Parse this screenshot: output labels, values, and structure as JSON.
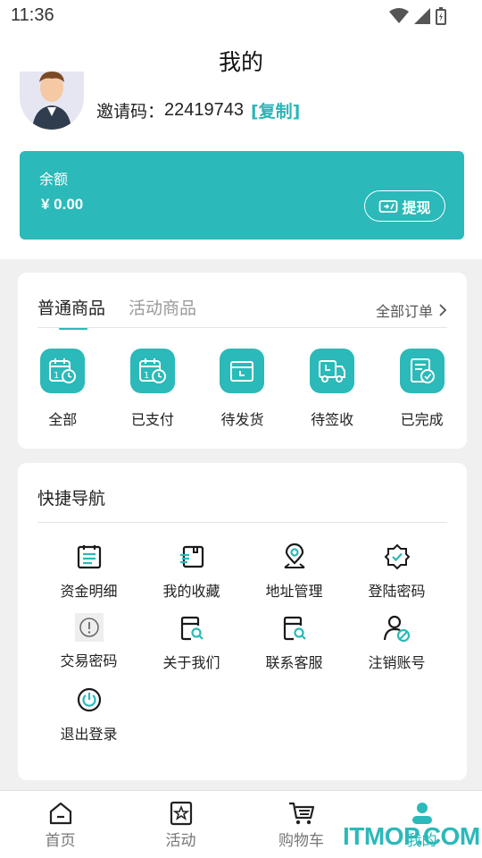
{
  "status_bar": {
    "time": "11:36"
  },
  "page": {
    "title": "我的"
  },
  "profile": {
    "invite_label": "邀请码：",
    "invite_code": "22419743",
    "copy_label": "[复制]"
  },
  "balance": {
    "label": "余额",
    "amount": "¥ 0.00",
    "withdraw_label": "提现"
  },
  "orders": {
    "tabs": [
      {
        "label": "普通商品"
      },
      {
        "label": "活动商品"
      }
    ],
    "all_orders_label": "全部订单",
    "items": [
      {
        "label": "全部",
        "icon": "calendar-clock-icon"
      },
      {
        "label": "已支付",
        "icon": "calendar-paid-icon"
      },
      {
        "label": "待发货",
        "icon": "box-icon"
      },
      {
        "label": "待签收",
        "icon": "truck-icon"
      },
      {
        "label": "已完成",
        "icon": "document-check-icon"
      }
    ]
  },
  "quick_nav": {
    "title": "快捷导航",
    "items": [
      {
        "label": "资金明细",
        "icon": "calendar-list-icon"
      },
      {
        "label": "我的收藏",
        "icon": "favorites-box-icon"
      },
      {
        "label": "地址管理",
        "icon": "location-pin-icon"
      },
      {
        "label": "登陆密码",
        "icon": "shield-check-icon"
      },
      {
        "label": "交易密码",
        "icon": "alert-circle-icon"
      },
      {
        "label": "关于我们",
        "icon": "search-doc-icon"
      },
      {
        "label": "联系客服",
        "icon": "service-doc-icon"
      },
      {
        "label": "注销账号",
        "icon": "user-block-icon"
      },
      {
        "label": "退出登录",
        "icon": "power-icon"
      }
    ]
  },
  "bottom_nav": {
    "items": [
      {
        "label": "首页",
        "icon": "home-icon"
      },
      {
        "label": "活动",
        "icon": "star-badge-icon"
      },
      {
        "label": "购物车",
        "icon": "cart-icon"
      },
      {
        "label": "我的",
        "icon": "user-icon"
      }
    ]
  },
  "watermark": {
    "text": "ITMOP.COM"
  },
  "colors": {
    "accent": "#2bb9b9"
  }
}
